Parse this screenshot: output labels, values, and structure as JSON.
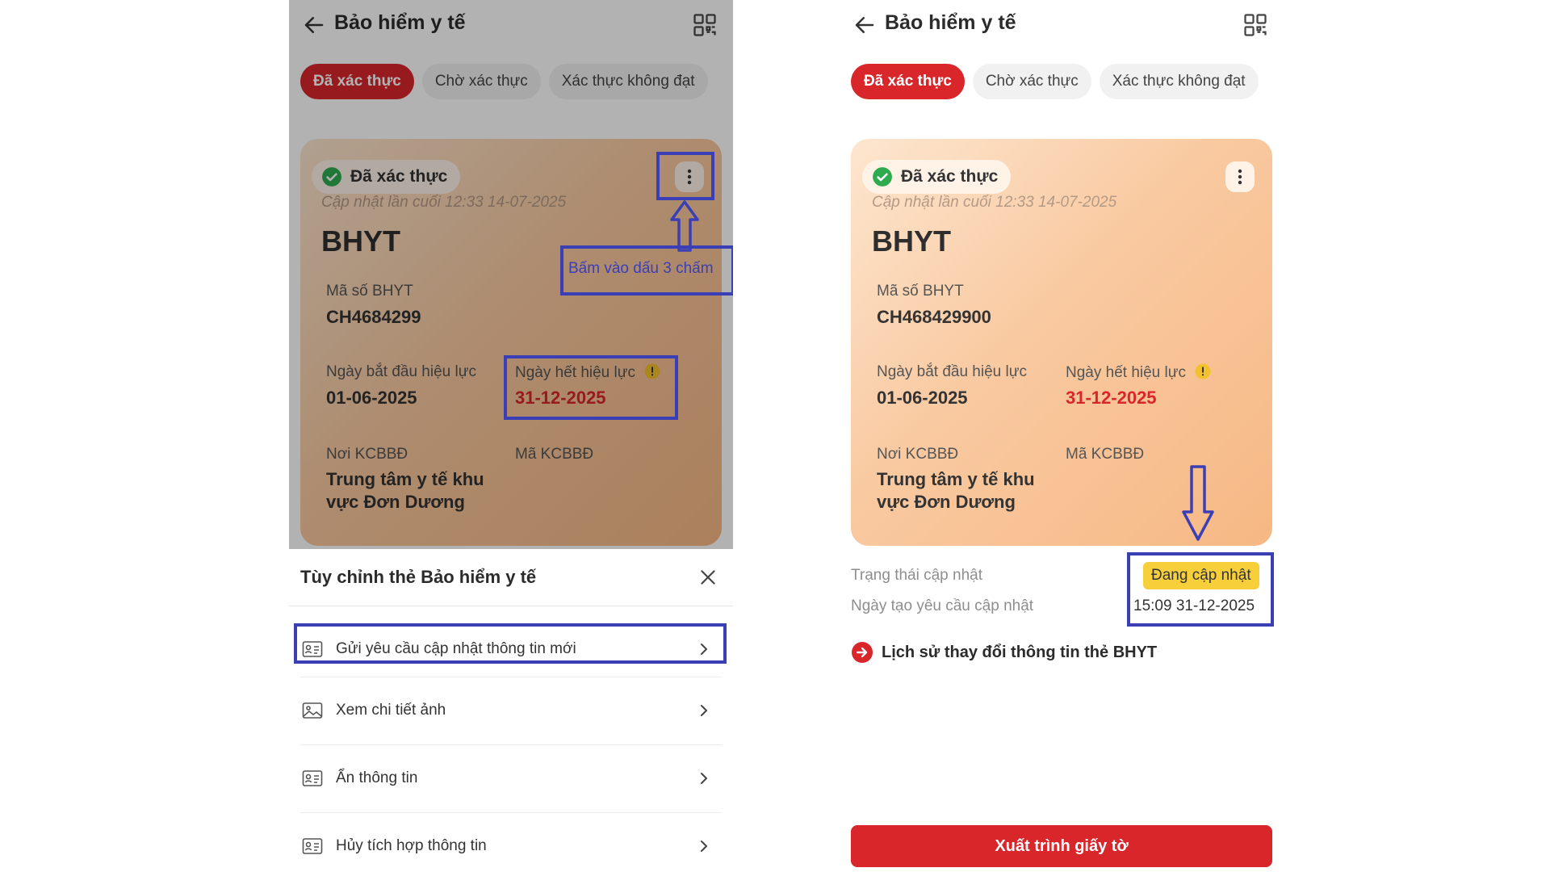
{
  "left": {
    "header": {
      "title": "Bảo hiểm y tế"
    },
    "tabs": [
      "Đã xác thực",
      "Chờ xác thực",
      "Xác thực không đạt"
    ],
    "card": {
      "badge": "Đã xác thực",
      "updated": "Cập nhật lần cuối 12:33 14-07-2025",
      "title": "BHYT",
      "ma_so_label": "Mã số BHYT",
      "ma_so_value": "CH4684299",
      "start_label": "Ngày bắt đầu hiệu lực",
      "start_value": "01-06-2025",
      "end_label": "Ngày hết hiệu lực",
      "end_value": "31-12-2025",
      "noi_label": "Nơi KCBBĐ",
      "noi_value": "Trung tâm y tế khu vực Đơn Dương",
      "ma_kcb_label": "Mã KCBBĐ"
    },
    "annotation": {
      "text": "Bấm vào dấu 3 chấm"
    },
    "sheet": {
      "title": "Tùy chỉnh thẻ Bảo hiểm y tế",
      "items": [
        "Gửi yêu cầu cập nhật thông tin mới",
        "Xem chi tiết ảnh",
        "Ẩn thông tin",
        "Hủy tích hợp thông tin"
      ]
    }
  },
  "right": {
    "header": {
      "title": "Bảo hiểm y tế"
    },
    "tabs": [
      "Đã xác thực",
      "Chờ xác thực",
      "Xác thực không đạt"
    ],
    "card": {
      "badge": "Đã xác thực",
      "updated": "Cập nhật lần cuối 12:33 14-07-2025",
      "title": "BHYT",
      "ma_so_label": "Mã số BHYT",
      "ma_so_value": "CH468429900",
      "start_label": "Ngày bắt đầu hiệu lực",
      "start_value": "01-06-2025",
      "end_label": "Ngày hết hiệu lực",
      "end_value": "31-12-2025",
      "noi_label": "Nơi KCBBĐ",
      "noi_value": "Trung tâm y tế khu vực Đơn Dương",
      "ma_kcb_label": "Mã KCBBĐ"
    },
    "status": {
      "label": "Trạng thái cập nhật",
      "badge": "Đang cập nhật",
      "request_label": "Ngày tạo yêu cầu cập nhật",
      "request_value": "15:09 31-12-2025"
    },
    "history_link": "Lịch sử thay đổi thông tin thẻ BHYT",
    "primary_button": "Xuất trình giấy tờ"
  },
  "colors": {
    "accent": "#d9262b",
    "annotation": "#3b3fb5",
    "verified": "#2eab4f",
    "warning": "#f2c12e",
    "status_badge": "#f7cf3a"
  },
  "icons": [
    "back-arrow-icon",
    "qr-icon",
    "check-icon",
    "more-vertical-icon",
    "warning-icon",
    "close-icon",
    "id-card-icon",
    "image-icon",
    "chevron-right-icon",
    "arrow-right-circle-icon"
  ]
}
